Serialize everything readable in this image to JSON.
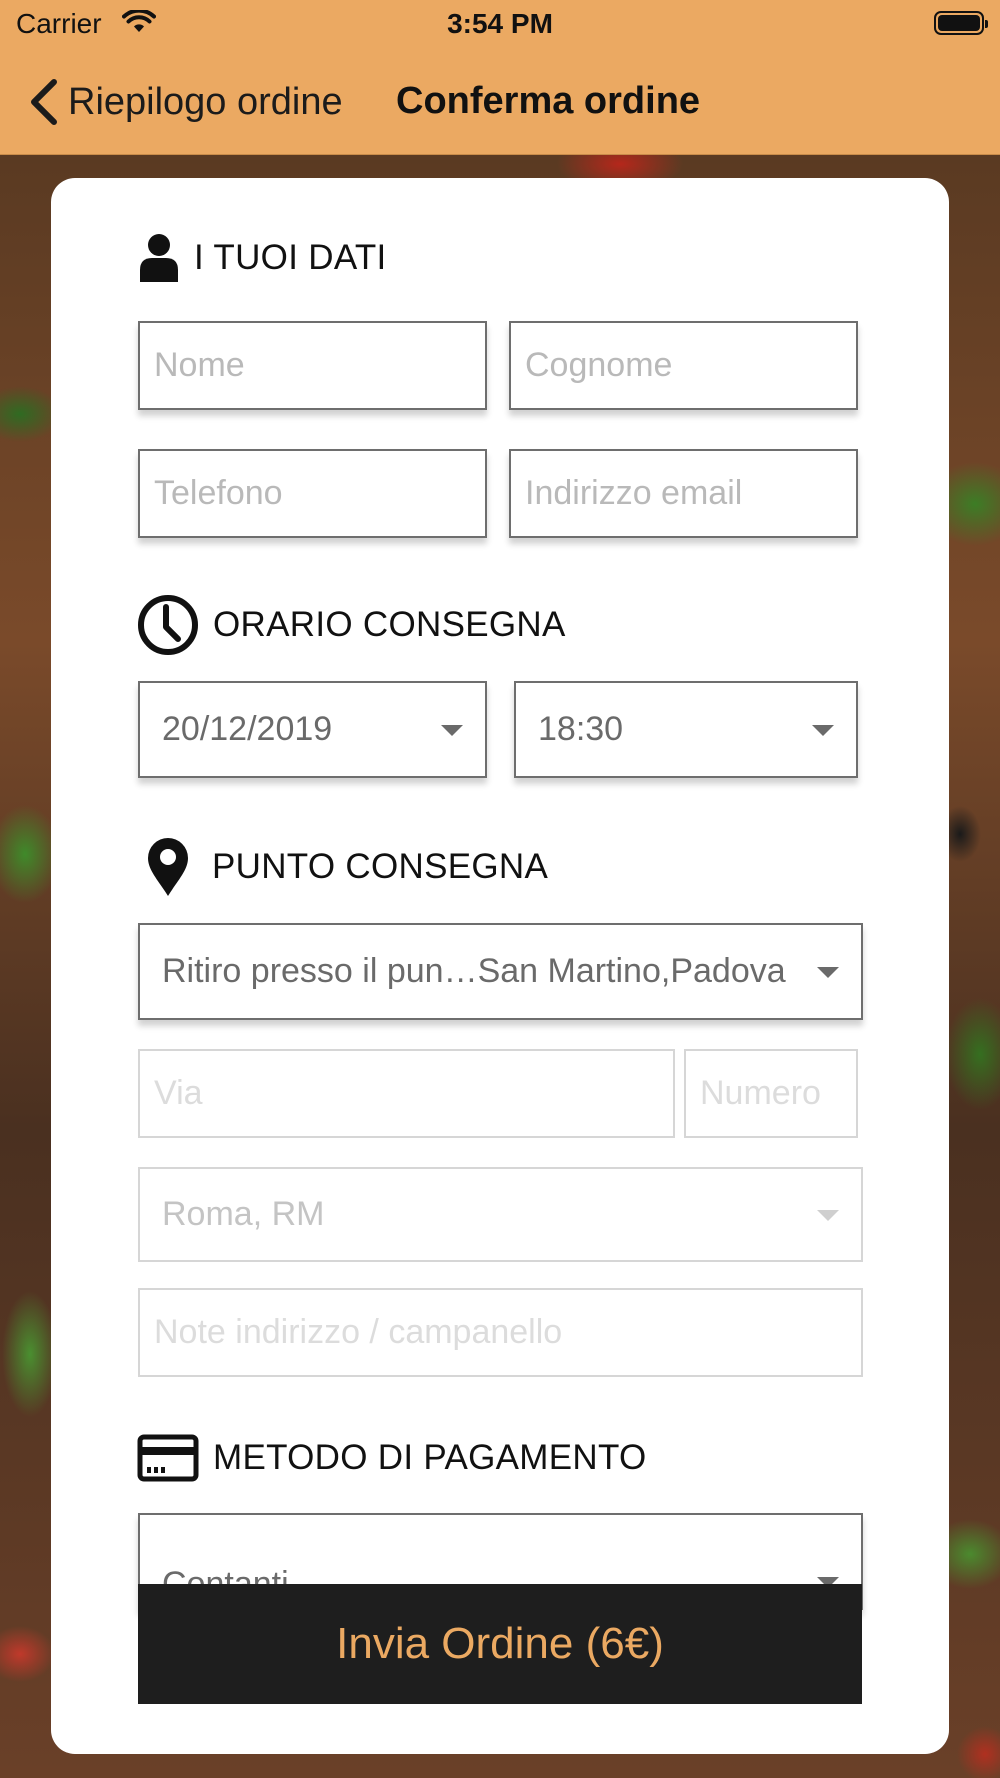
{
  "status_bar": {
    "carrier": "Carrier",
    "time": "3:54 PM"
  },
  "nav": {
    "back_label": "Riepilogo ordine",
    "title": "Conferma ordine"
  },
  "sections": {
    "personal": {
      "title": "I TUOI DATI",
      "fields": {
        "first_name": "Nome",
        "last_name": "Cognome",
        "phone": "Telefono",
        "email": "Indirizzo email"
      }
    },
    "delivery_time": {
      "title": "ORARIO CONSEGNA",
      "date": "20/12/2019",
      "time": "18:30"
    },
    "delivery_point": {
      "title": "PUNTO CONSEGNA",
      "selected": "Ritiro presso il pun…San Martino,Padova",
      "street_placeholder": "Via",
      "number_placeholder": "Numero",
      "city": "Roma, RM",
      "notes_placeholder": "Note indirizzo / campanello"
    },
    "payment": {
      "title": "METODO DI PAGAMENTO",
      "selected": "Contanti"
    }
  },
  "submit_label": "Invia Ordine (6€)",
  "colors": {
    "accent": "#eba962",
    "dark": "#1e1e1e"
  },
  "icons": [
    "wifi-icon",
    "battery-icon",
    "chevron-left-icon",
    "user-icon",
    "clock-icon",
    "location-pin-icon",
    "credit-card-icon",
    "caret-down-icon"
  ]
}
